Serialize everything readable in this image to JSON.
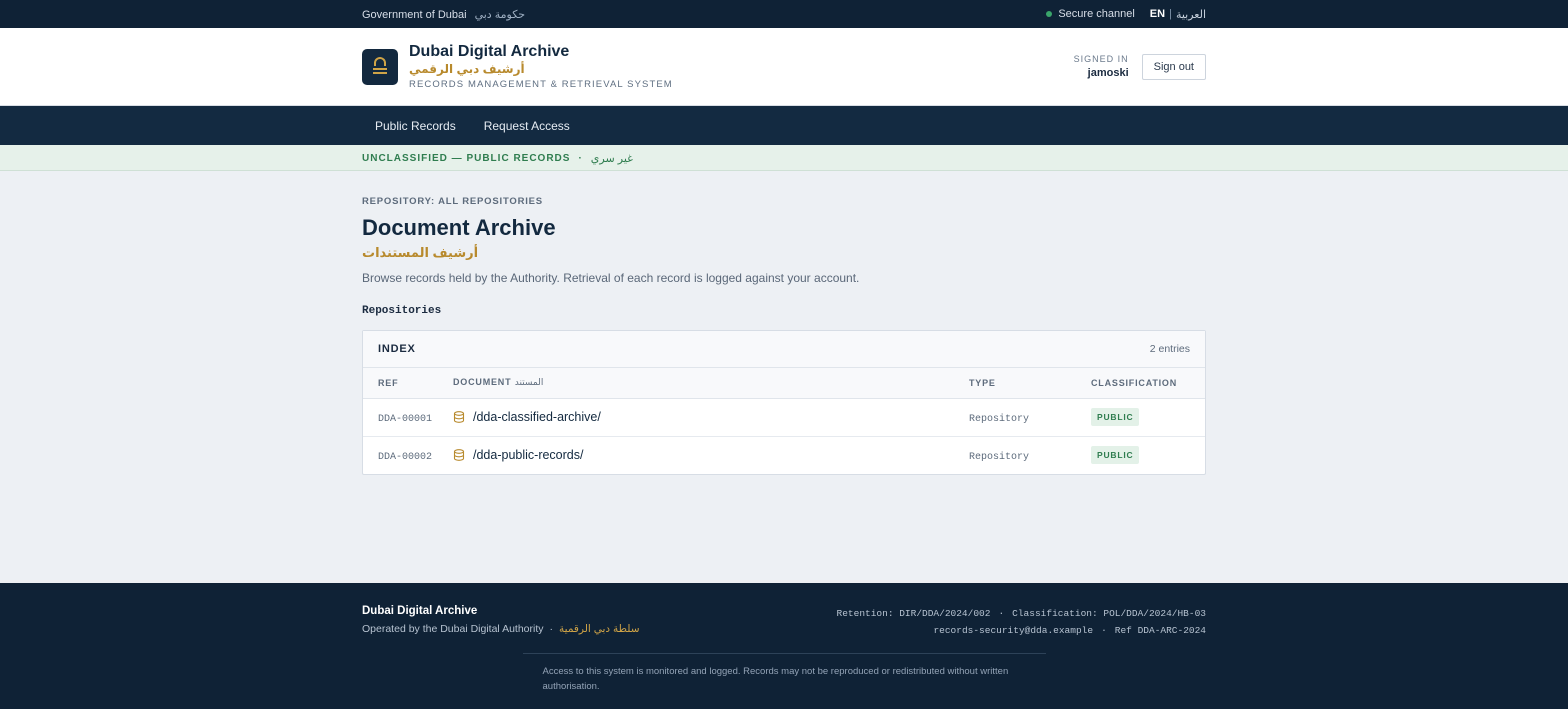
{
  "topbar": {
    "gov_en": "Government of Dubai",
    "gov_ar": "حكومة دبي",
    "secure": "Secure channel",
    "lang_en": "EN",
    "lang_sep": "|",
    "lang_ar": "العربية"
  },
  "header": {
    "title": "Dubai Digital Archive",
    "title_ar": "أرشيف دبي الرقمي",
    "subtitle": "RECORDS MANAGEMENT & RETRIEVAL SYSTEM",
    "signed_in_label": "SIGNED IN",
    "username": "jamoski",
    "signout_label": "Sign out"
  },
  "nav": {
    "items": [
      {
        "label": "Public Records"
      },
      {
        "label": "Request Access"
      }
    ]
  },
  "classification": {
    "label": "UNCLASSIFIED — PUBLIC RECORDS",
    "sep": "·",
    "ar": "غير سري"
  },
  "main": {
    "repository_label": "REPOSITORY: ALL REPOSITORIES",
    "title": "Document Archive",
    "title_ar": "أرشيف المستندات",
    "intro": "Browse records held by the Authority. Retrieval of each record is logged against your account.",
    "section": "Repositories"
  },
  "index": {
    "title": "INDEX",
    "count": "2 entries",
    "columns": {
      "ref": "REF",
      "document": "DOCUMENT",
      "document_ar": "المستند",
      "type": "TYPE",
      "classification": "CLASSIFICATION"
    },
    "rows": [
      {
        "ref": "DDA-00001",
        "document": "/dda-classified-archive/",
        "type": "Repository",
        "classification": "PUBLIC"
      },
      {
        "ref": "DDA-00002",
        "document": "/dda-public-records/",
        "type": "Repository",
        "classification": "PUBLIC"
      }
    ]
  },
  "footer": {
    "title": "Dubai Digital Archive",
    "operated": "Operated by the Dubai Digital Authority",
    "sep": "·",
    "operated_ar": "سلطة دبي الرقمية",
    "retention": "Retention: DIR/DDA/2024/002",
    "classification": "Classification: POL/DDA/2024/HB-03",
    "email": "records-security@dda.example",
    "ref": "Ref DDA-ARC-2024",
    "notice": "Access to this system is monitored and logged. Records may not be reproduced or redistributed without written authorisation."
  },
  "colors": {
    "navy": "#0f2236",
    "gold": "#b88a2d",
    "public_green": "#2f7d4f"
  },
  "icons": {
    "logo": "archive-icon",
    "status": "secure-dot-icon",
    "row": "database-icon"
  }
}
